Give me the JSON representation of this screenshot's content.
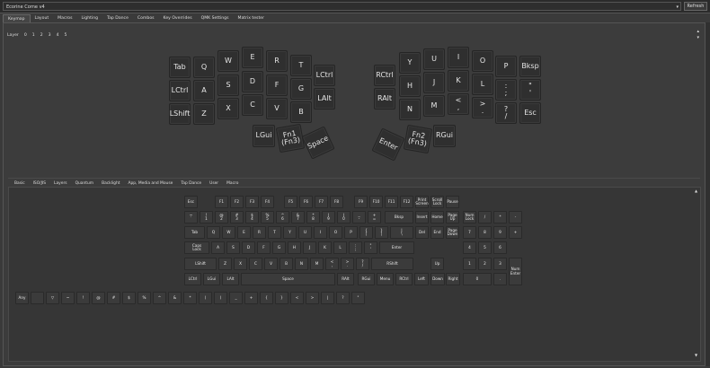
{
  "header": {
    "keyboard_select": "Ecorine Corne v4",
    "refresh_label": "Refresh"
  },
  "tabs": [
    "Keymap",
    "Layout",
    "Macros",
    "Lighting",
    "Tap Dance",
    "Combos",
    "Key Overrides",
    "QMK Settings",
    "Matrix tester"
  ],
  "layers": {
    "label": "Layer",
    "items": [
      "0",
      "1",
      "2",
      "3",
      "4",
      "5"
    ]
  },
  "keymap": {
    "left": [
      {
        "id": "tab",
        "label": "Tab"
      },
      {
        "id": "q",
        "label": "Q"
      },
      {
        "id": "w",
        "label": "W"
      },
      {
        "id": "e",
        "label": "E"
      },
      {
        "id": "r",
        "label": "R"
      },
      {
        "id": "t",
        "label": "T"
      },
      {
        "id": "lctrl",
        "label": "LCtrl"
      },
      {
        "id": "a",
        "label": "A"
      },
      {
        "id": "s",
        "label": "S"
      },
      {
        "id": "d",
        "label": "D"
      },
      {
        "id": "f",
        "label": "F"
      },
      {
        "id": "g",
        "label": "G"
      },
      {
        "id": "lshift",
        "label": "LShift"
      },
      {
        "id": "z",
        "label": "Z"
      },
      {
        "id": "x",
        "label": "X"
      },
      {
        "id": "c",
        "label": "C"
      },
      {
        "id": "v",
        "label": "V"
      },
      {
        "id": "b",
        "label": "B"
      },
      {
        "id": "lctrl2",
        "label": "LCtrl"
      },
      {
        "id": "lalt",
        "label": "LAlt"
      }
    ],
    "right": [
      {
        "id": "rctrl",
        "label": "RCtrl"
      },
      {
        "id": "y",
        "label": "Y"
      },
      {
        "id": "u",
        "label": "U"
      },
      {
        "id": "i",
        "label": "I"
      },
      {
        "id": "o",
        "label": "O"
      },
      {
        "id": "p",
        "label": "P"
      },
      {
        "id": "bksp",
        "label": "Bksp"
      },
      {
        "id": "ralt",
        "label": "RAlt"
      },
      {
        "id": "h",
        "label": "H"
      },
      {
        "id": "j",
        "label": "J"
      },
      {
        "id": "k",
        "label": "K"
      },
      {
        "id": "l",
        "label": "L"
      },
      {
        "id": "semi",
        "label": ":\n;"
      },
      {
        "id": "quote",
        "label": "\"\n'"
      },
      {
        "id": "n",
        "label": "N"
      },
      {
        "id": "m",
        "label": "M"
      },
      {
        "id": "comma",
        "label": "<\n,"
      },
      {
        "id": "dot",
        "label": ">\n."
      },
      {
        "id": "slash",
        "label": "?\n/"
      },
      {
        "id": "esc",
        "label": "Esc"
      }
    ],
    "thumbs": {
      "lgui": "LGui",
      "fn1": "Fn1\n(Fn3)",
      "space": "Space",
      "enter": "Enter",
      "fn2": "Fn2\n(Fn3)",
      "rgui": "RGui"
    }
  },
  "subtabs": [
    "Basic",
    "ISO/JIS",
    "Layers",
    "Quantum",
    "Backlight",
    "App, Media and Mouse",
    "Tap Dance",
    "User",
    "Macro"
  ],
  "keyboard_rows": [
    [
      "Esc",
      "F1",
      "F2",
      "F3",
      "F4",
      "F5",
      "F6",
      "F7",
      "F8",
      "F9",
      "F10",
      "F11",
      "F12",
      "Print\nScreen",
      "Scroll\nLock",
      "Pause"
    ],
    [
      "~\n`",
      "!\n1",
      "@\n2",
      "#\n3",
      "$\n4",
      "%\n5",
      "^\n6",
      "&\n7",
      "*\n8",
      "(\n9",
      ")\n0",
      "_\n-",
      "+\n=",
      "Bksp",
      "Insert",
      "Home",
      "Page\nUp",
      "Num\nLock",
      "/",
      "*",
      "-"
    ],
    [
      "Tab",
      "Q",
      "W",
      "E",
      "R",
      "T",
      "Y",
      "U",
      "I",
      "O",
      "P",
      "{\n[",
      "}\n]",
      "|\n\\",
      "Del",
      "End",
      "Page\nDown",
      "7",
      "8",
      "9",
      "+"
    ],
    [
      "Caps\nLock",
      "A",
      "S",
      "D",
      "F",
      "G",
      "H",
      "J",
      "K",
      "L",
      ":\n;",
      "\"\n'",
      "Enter",
      "4",
      "5",
      "6"
    ],
    [
      "LShift",
      "Z",
      "X",
      "C",
      "V",
      "B",
      "N",
      "M",
      "<\n,",
      ">\n.",
      "?\n/",
      "RShift",
      "Up",
      "1",
      "2",
      "3",
      "Num\nEnter"
    ],
    [
      "LCtrl",
      "LGui",
      "LAlt",
      "Space",
      "RAlt",
      "RGui",
      "Menu",
      "RCtrl",
      "Left",
      "Down",
      "Right",
      "0",
      "."
    ]
  ],
  "bottom_row": [
    "Any",
    "",
    "▽",
    "~",
    "!",
    "@",
    "#",
    "$",
    "%",
    "^",
    "&",
    "*",
    "(",
    ")",
    "_",
    "+",
    "{",
    "}",
    "<",
    ">",
    "|",
    "?",
    "\""
  ]
}
